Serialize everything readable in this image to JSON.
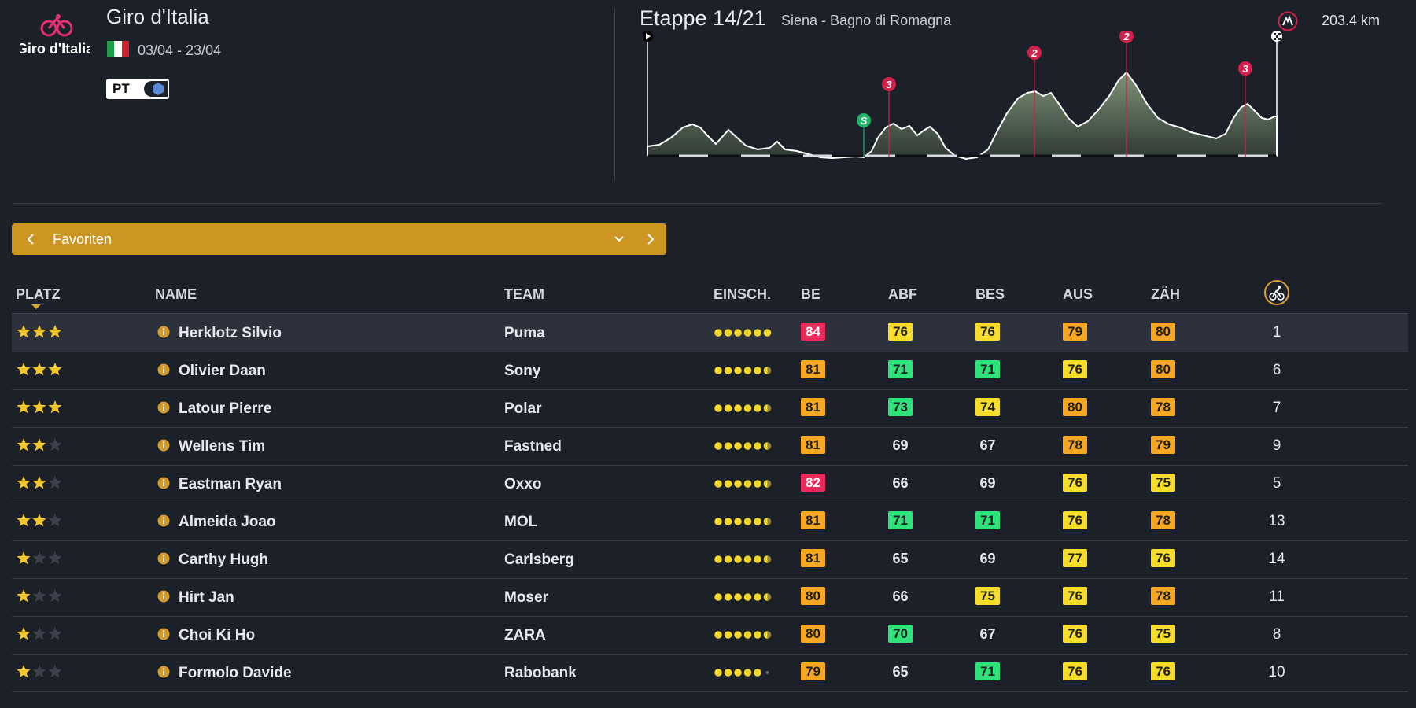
{
  "race": {
    "title": "Giro d'Italia",
    "logo_text": "Giro d'Italia",
    "dates": "03/04 - 23/04",
    "flag_colors": [
      "#1f9e46",
      "#ffffff",
      "#d2232a"
    ],
    "badge": "PT"
  },
  "stage": {
    "title": "Etappe 14/21",
    "route": "Siena - Bagno di Romagna",
    "distance": "203.4 km",
    "markers": [
      {
        "type": "sprint",
        "label": "S",
        "color": "#22b56a"
      },
      {
        "type": "climb",
        "label": "3",
        "color": "#d1204a"
      },
      {
        "type": "climb",
        "label": "2",
        "color": "#d1204a"
      },
      {
        "type": "climb",
        "label": "2",
        "color": "#d1204a"
      },
      {
        "type": "climb",
        "label": "3",
        "color": "#d1204a"
      }
    ]
  },
  "filter": {
    "label": "Favoriten",
    "accent": "#cd9522"
  },
  "columns": {
    "rank": "PLATZ",
    "name": "NAME",
    "team": "TEAM",
    "rating": "EINSCH.",
    "be": "BE",
    "abf": "ABF",
    "bes": "BES",
    "aus": "AUS",
    "zah": "ZÄH"
  },
  "stat_colors": {
    "red": "#ea2a5b",
    "orange": "#f5a623",
    "yellow": "#f6dd2a",
    "green": "#2de37a"
  },
  "riders": [
    {
      "stars": 3,
      "name": "Herklotz Silvio",
      "team": "Puma",
      "rating": 6,
      "be": {
        "v": "84",
        "c": "red"
      },
      "abf": {
        "v": "76",
        "c": "yellow"
      },
      "bes": {
        "v": "76",
        "c": "yellow"
      },
      "aus": {
        "v": "79",
        "c": "orange"
      },
      "zah": {
        "v": "80",
        "c": "orange"
      },
      "num": "1",
      "selected": true
    },
    {
      "stars": 3,
      "name": "Olivier Daan",
      "team": "Sony",
      "rating": 5.5,
      "be": {
        "v": "81",
        "c": "orange"
      },
      "abf": {
        "v": "71",
        "c": "green"
      },
      "bes": {
        "v": "71",
        "c": "green"
      },
      "aus": {
        "v": "76",
        "c": "yellow"
      },
      "zah": {
        "v": "80",
        "c": "orange"
      },
      "num": "6"
    },
    {
      "stars": 3,
      "name": "Latour Pierre",
      "team": "Polar",
      "rating": 5.5,
      "be": {
        "v": "81",
        "c": "orange"
      },
      "abf": {
        "v": "73",
        "c": "green"
      },
      "bes": {
        "v": "74",
        "c": "yellow"
      },
      "aus": {
        "v": "80",
        "c": "orange"
      },
      "zah": {
        "v": "78",
        "c": "orange"
      },
      "num": "7"
    },
    {
      "stars": 2,
      "name": "Wellens Tim",
      "team": "Fastned",
      "rating": 5.5,
      "be": {
        "v": "81",
        "c": "orange"
      },
      "abf": {
        "v": "69",
        "c": "none"
      },
      "bes": {
        "v": "67",
        "c": "none"
      },
      "aus": {
        "v": "78",
        "c": "orange"
      },
      "zah": {
        "v": "79",
        "c": "orange"
      },
      "num": "9"
    },
    {
      "stars": 2,
      "name": "Eastman Ryan",
      "team": "Oxxo",
      "rating": 5.5,
      "be": {
        "v": "82",
        "c": "red"
      },
      "abf": {
        "v": "66",
        "c": "none"
      },
      "bes": {
        "v": "69",
        "c": "none"
      },
      "aus": {
        "v": "76",
        "c": "yellow"
      },
      "zah": {
        "v": "75",
        "c": "yellow"
      },
      "num": "5"
    },
    {
      "stars": 2,
      "name": "Almeida Joao",
      "team": "MOL",
      "rating": 5.5,
      "be": {
        "v": "81",
        "c": "orange"
      },
      "abf": {
        "v": "71",
        "c": "green"
      },
      "bes": {
        "v": "71",
        "c": "green"
      },
      "aus": {
        "v": "76",
        "c": "yellow"
      },
      "zah": {
        "v": "78",
        "c": "orange"
      },
      "num": "13"
    },
    {
      "stars": 1,
      "name": "Carthy Hugh",
      "team": "Carlsberg",
      "rating": 5.5,
      "be": {
        "v": "81",
        "c": "orange"
      },
      "abf": {
        "v": "65",
        "c": "none"
      },
      "bes": {
        "v": "69",
        "c": "none"
      },
      "aus": {
        "v": "77",
        "c": "yellow"
      },
      "zah": {
        "v": "76",
        "c": "yellow"
      },
      "num": "14"
    },
    {
      "stars": 1,
      "name": "Hirt Jan",
      "team": "Moser",
      "rating": 5.5,
      "be": {
        "v": "80",
        "c": "orange"
      },
      "abf": {
        "v": "66",
        "c": "none"
      },
      "bes": {
        "v": "75",
        "c": "yellow"
      },
      "aus": {
        "v": "76",
        "c": "yellow"
      },
      "zah": {
        "v": "78",
        "c": "orange"
      },
      "num": "11"
    },
    {
      "stars": 1,
      "name": "Choi Ki Ho",
      "team": "ZARA",
      "rating": 5.5,
      "be": {
        "v": "80",
        "c": "orange"
      },
      "abf": {
        "v": "70",
        "c": "green"
      },
      "bes": {
        "v": "67",
        "c": "none"
      },
      "aus": {
        "v": "76",
        "c": "yellow"
      },
      "zah": {
        "v": "75",
        "c": "yellow"
      },
      "num": "8"
    },
    {
      "stars": 1,
      "name": "Formolo Davide",
      "team": "Rabobank",
      "rating": 5,
      "be": {
        "v": "79",
        "c": "orange"
      },
      "abf": {
        "v": "65",
        "c": "none"
      },
      "bes": {
        "v": "71",
        "c": "green"
      },
      "aus": {
        "v": "76",
        "c": "yellow"
      },
      "zah": {
        "v": "76",
        "c": "yellow"
      },
      "num": "10"
    }
  ]
}
